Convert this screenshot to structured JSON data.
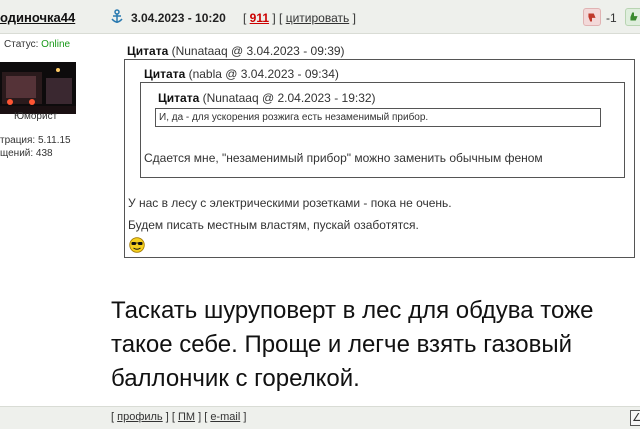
{
  "post": {
    "author": "одиночка44",
    "date": "3.04.2023 - 10:20",
    "link_open": "[ ",
    "post_number": "911",
    "link_mid": " ] [ ",
    "quote_label": "цитировать",
    "link_close": " ]",
    "vote_count": "-1"
  },
  "user": {
    "status_label": "Статус: ",
    "status_value": "Online",
    "rank": "Юморист",
    "registration": "трация: 5.11.15",
    "messages": "щений: 438"
  },
  "quotes": {
    "outer": {
      "label": "Цитата",
      "meta": " (Nunataaq @ 3.04.2023 - 09:39)",
      "line1": "У нас в лесу с электрическими розетками - пока не очень.",
      "line2": "Будем писать местным властям, пускай озаботятся."
    },
    "middle": {
      "label": "Цитата",
      "meta": " (nabla @ 3.04.2023 - 09:34)",
      "text": "Сдается мне, \"незаменимый прибор\" можно заменить обычным феном"
    },
    "inner": {
      "label": "Цитата",
      "meta": " (Nunataaq @ 2.04.2023 - 19:32)",
      "text": "И, да - для ускорения розжига есть незаменимый прибор."
    }
  },
  "body_text": "Таскать шуруповерт в лес для обдува тоже такое себе. Проще и легче взять газовый баллончик с горелкой.",
  "footer": {
    "open": "[ ",
    "profile": "профиль",
    "sep1": " ] [ ",
    "pm": "ПМ",
    "sep2": " ] [ ",
    "email": "e-mail",
    "close": " ]",
    "up_arrow": "∠"
  },
  "icons": {
    "anchor": "anchor-icon",
    "thumb_down": "thumb-down-icon",
    "thumb_up": "thumb-up-icon",
    "smiley": "cool-smiley-icon"
  },
  "colors": {
    "header_bg": "#eef0ec",
    "online": "#1a9a1a",
    "post_number": "#cc0000"
  }
}
